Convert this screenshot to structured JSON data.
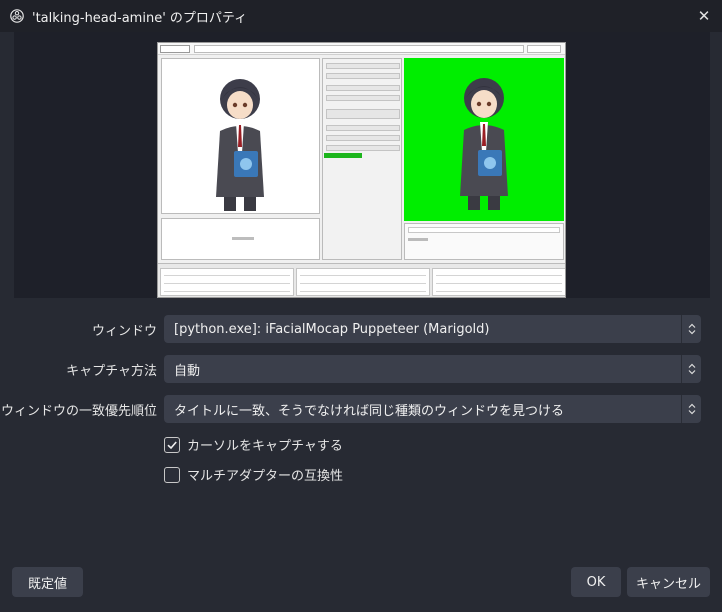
{
  "window": {
    "title": "'talking-head-amine' のプロパティ",
    "close_glyph": "✕"
  },
  "form": {
    "window_label": "ウィンドウ",
    "window_value": "[python.exe]: iFacialMocap Puppeteer (Marigold)",
    "capture_method_label": "キャプチャ方法",
    "capture_method_value": "自動",
    "priority_label": "ウィンドウの一致優先順位",
    "priority_value": "タイトルに一致、そうでなければ同じ種類のウィンドウを見つける",
    "capture_cursor_label": "カーソルをキャプチャする",
    "capture_cursor_checked": true,
    "multi_adapter_label": "マルチアダプターの互換性",
    "multi_adapter_checked": false
  },
  "buttons": {
    "defaults": "既定値",
    "ok": "OK",
    "cancel": "キャンセル"
  },
  "icons": {
    "title_logo": "obs-logo-icon",
    "close": "close-icon",
    "select_arrows": "updown-arrows-icon",
    "checkmark": "checkmark-icon"
  },
  "colors": {
    "background": "#272a33",
    "titlebar": "#1f2128",
    "control": "#3b3f4b",
    "preview_green": "#00ee00"
  }
}
